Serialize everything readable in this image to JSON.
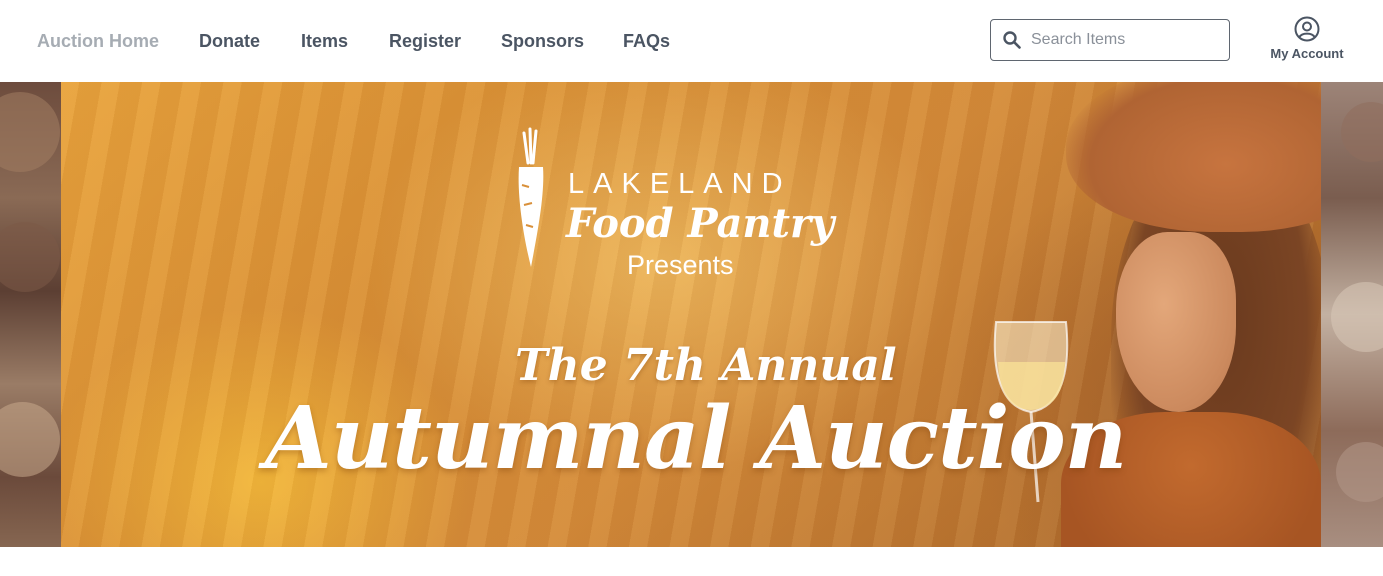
{
  "nav": {
    "items": [
      {
        "label": "Auction Home",
        "active": true
      },
      {
        "label": "Donate"
      },
      {
        "label": "Items"
      },
      {
        "label": "Register"
      },
      {
        "label": "Sponsors"
      },
      {
        "label": "FAQs"
      }
    ],
    "search": {
      "placeholder": "Search Items",
      "icon": "search-icon"
    },
    "account": {
      "label": "My Account",
      "icon": "user-circle-icon"
    }
  },
  "banner": {
    "logo_line1": "LAKELAND",
    "logo_line2": "Food Pantry",
    "presents": "Presents",
    "subtitle": "The 7th Annual",
    "title": "Autumnal Auction"
  },
  "colors": {
    "nav_text": "#4b5563",
    "nav_active": "#a6acb3",
    "banner_base": "#d98f35"
  }
}
